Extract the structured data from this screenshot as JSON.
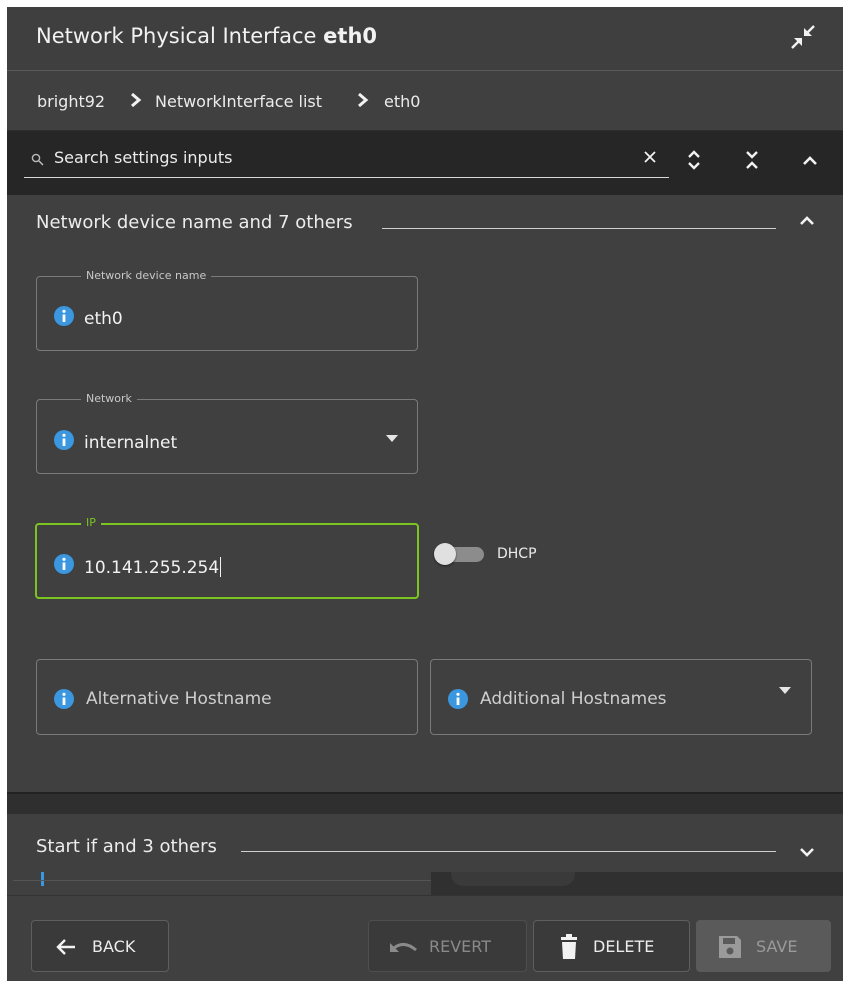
{
  "header": {
    "title_prefix": "Network Physical Interface ",
    "title_name": "eth0"
  },
  "breadcrumb": [
    "bright92",
    "NetworkInterface list",
    "eth0"
  ],
  "search": {
    "placeholder": "Search settings inputs"
  },
  "section1": {
    "title": "Network device name and 7 others",
    "fields": {
      "device_name": {
        "label": "Network device name",
        "value": "eth0"
      },
      "network": {
        "label": "Network",
        "value": "internalnet"
      },
      "ip": {
        "label": "IP",
        "value": "10.141.255.254"
      },
      "dhcp": {
        "label": "DHCP",
        "on": false
      },
      "alt_hostname": {
        "placeholder": "Alternative Hostname"
      },
      "additional_hostnames": {
        "placeholder": "Additional Hostnames"
      }
    }
  },
  "section2": {
    "title": "Start if and 3 others"
  },
  "footer": {
    "back": "BACK",
    "revert": "REVERT",
    "delete": "DELETE",
    "save": "SAVE"
  },
  "colors": {
    "panel": "#404040",
    "focus_border": "#7cc520",
    "info_icon": "#3a97e0"
  },
  "icons": [
    "collapse-icon",
    "chevron-right-icon",
    "search-icon",
    "close-icon",
    "expand-all-icon",
    "collapse-all-icon",
    "chevron-up-icon",
    "chevron-down-icon",
    "info-icon",
    "dropdown-arrow-icon",
    "arrow-left-icon",
    "undo-icon",
    "trash-icon",
    "floppy-icon"
  ]
}
